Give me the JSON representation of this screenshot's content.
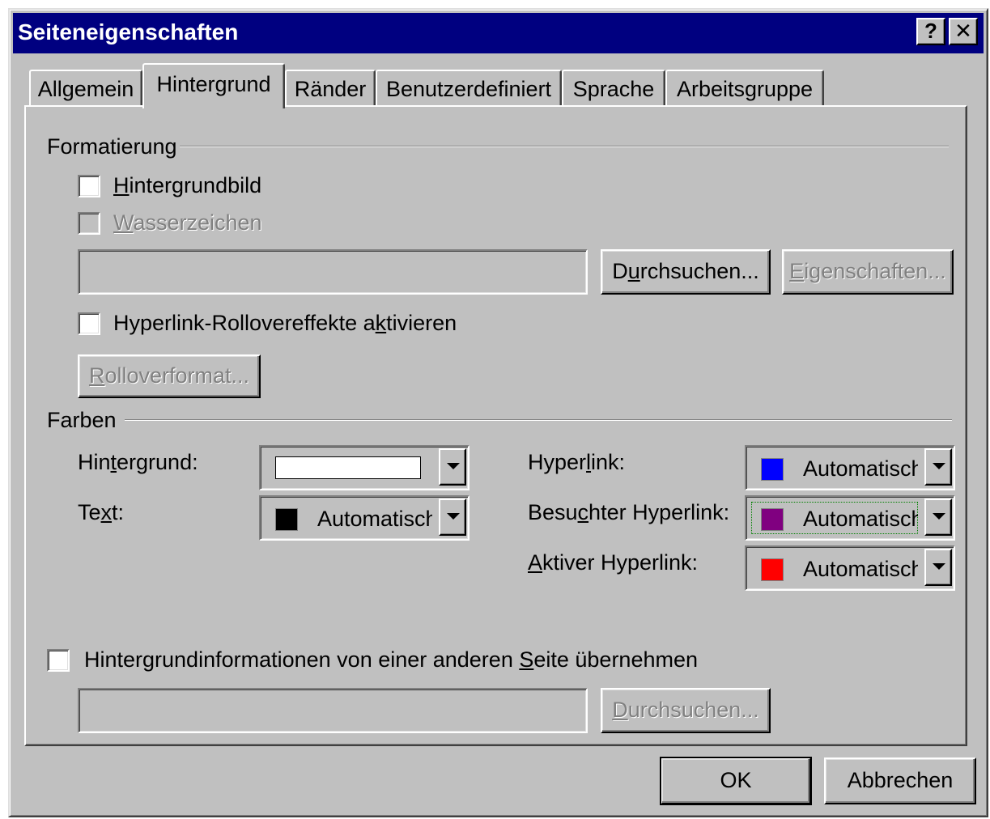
{
  "window": {
    "title": "Seiteneigenschaften",
    "help_button": "?",
    "close_button": "✕"
  },
  "tabs": [
    {
      "label": "Allgemein",
      "active": false
    },
    {
      "label": "Hintergrund",
      "active": true
    },
    {
      "label": "Ränder",
      "active": false
    },
    {
      "label": "Benutzerdefiniert",
      "active": false
    },
    {
      "label": "Sprache",
      "active": false
    },
    {
      "label": "Arbeitsgruppe",
      "active": false
    }
  ],
  "formatting": {
    "group_label": "Formatierung",
    "background_image": {
      "pre": "",
      "ul": "H",
      "post": "intergrundbild",
      "checked": false
    },
    "watermark": {
      "pre": "",
      "ul": "W",
      "post": "asserzeichen",
      "checked": false,
      "enabled": false
    },
    "image_path": "",
    "browse_button": {
      "pre": "D",
      "ul": "u",
      "post": "rchsuchen..."
    },
    "properties_button": {
      "pre": "",
      "ul": "E",
      "post": "igenschaften...",
      "enabled": false
    },
    "rollover": {
      "pre": "Hyperlink-Rollovereffekte a",
      "ul": "k",
      "post": "tivieren",
      "checked": false
    },
    "rollover_format_button": {
      "pre": "",
      "ul": "R",
      "post": "olloverformat...",
      "enabled": false
    }
  },
  "colors": {
    "group_label": "Farben",
    "background": {
      "pre": "Hin",
      "ul": "t",
      "post": "ergrund:",
      "value": "",
      "swatch": "#ffffff"
    },
    "text": {
      "pre": "Te",
      "ul": "x",
      "post": "t:",
      "value": "Automatisch",
      "swatch": "#000000"
    },
    "hyperlink": {
      "pre": "Hyper",
      "ul": "l",
      "post": "ink:",
      "value": "Automatisch",
      "swatch": "#0000ff"
    },
    "visited": {
      "pre": "Besu",
      "ul": "c",
      "post": "hter Hyperlink:",
      "value": "Automatisch",
      "swatch": "#800080"
    },
    "active": {
      "pre": "",
      "ul": "A",
      "post": "ktiver Hyperlink:",
      "value": "Automatisch",
      "swatch": "#ff0000"
    }
  },
  "inherit": {
    "pre": "Hintergrundinformationen von einer anderen ",
    "ul": "S",
    "post": "eite übernehmen",
    "checked": false,
    "path": "",
    "browse_button": {
      "pre": "",
      "ul": "D",
      "post": "urchsuchen...",
      "enabled": false
    }
  },
  "footer": {
    "ok": "OK",
    "cancel": "Abbrechen"
  }
}
